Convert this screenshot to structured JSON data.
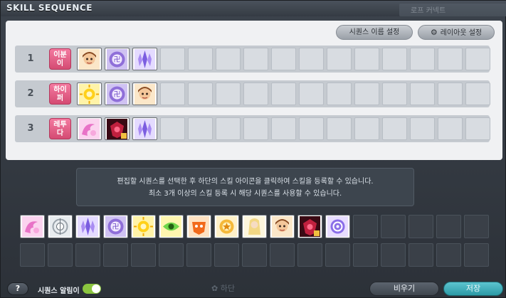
{
  "window": {
    "title": "SKILL SEQUENCE",
    "background_tag": "로프 커넥트"
  },
  "buttons": {
    "rename": "시퀀스 이름 설정",
    "layout": "레이아웃 설정",
    "empty": "비우기",
    "save": "저장"
  },
  "sequences": [
    {
      "number": "1",
      "tag": "이분\n이",
      "skills": [
        "monk-face-icon",
        "purple-rune-icon",
        "violet-crystal-icon"
      ]
    },
    {
      "number": "2",
      "tag": "하이\n퍼",
      "skills": [
        "sun-burst-icon",
        "purple-rune-icon",
        "monk-face-icon"
      ]
    },
    {
      "number": "3",
      "tag": "레투\n다",
      "skills": [
        "pink-swirl-icon",
        "crimson-crest-icon",
        "violet-crystal-icon"
      ]
    }
  ],
  "info": {
    "line1": "편집할 시퀀스를 선택한 후 하단의 스킬 아이콘을 클릭하여 스킬을 등록할 수 있습니다.",
    "line2": "최소 3개 이상의 스킬 등록 시 해당 시퀀스를 사용할 수 있습니다."
  },
  "skill_palette": [
    "pink-swirl-icon",
    "white-halo-icon",
    "violet-crystal-icon",
    "purple-rune-icon",
    "sun-burst-icon",
    "green-eye-icon",
    "orange-mask-icon",
    "gold-seal-icon",
    "blonde-warrior-icon",
    "monk-face-icon",
    "crimson-crest-icon",
    "violet-orb-icon"
  ],
  "footer": {
    "help": "?",
    "alarm_label": "시퀀스 알림이",
    "alarm_on": true,
    "ghost_text": "하단"
  },
  "colors": {
    "tag_pink": "#e05a80",
    "save_teal": "#3aaeb9",
    "toggle_green": "#8bc53f"
  }
}
